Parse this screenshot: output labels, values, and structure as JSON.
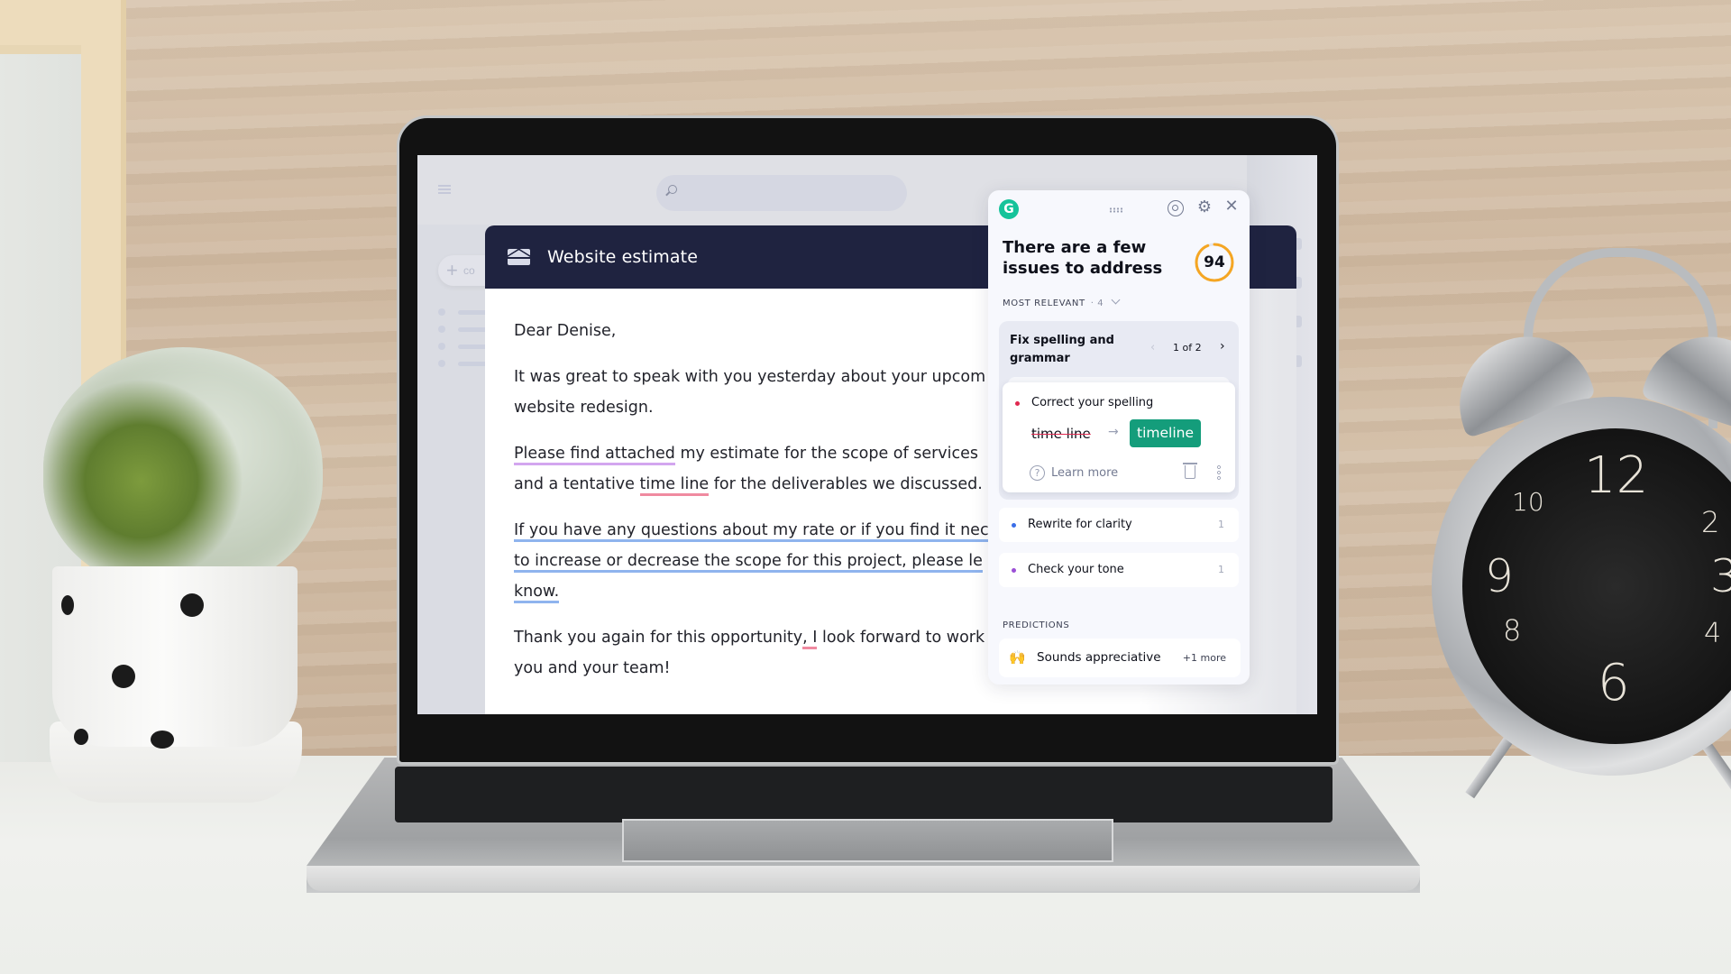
{
  "email_app": {
    "search": {
      "placeholder": ""
    },
    "compose_button_label": "co",
    "compose_window": {
      "title": "Website estimate",
      "body": {
        "greeting": "Dear Denise,",
        "paragraph1": {
          "line1": "It was great to speak with you yesterday about your upcom",
          "line2": "website redesign."
        },
        "paragraph2": {
          "flagged_tone": "Please find attached",
          "line1_rest": " my estimate for the scope of services",
          "line2_start": "and a tentative ",
          "flagged_spelling": "time line",
          "line2_rest": " for the deliverables we discussed."
        },
        "paragraph3": {
          "line1": "If you have any questions about my rate or if you find it nec",
          "line2": "to increase or decrease the scope for this project, please le",
          "line3": "know."
        },
        "paragraph4": {
          "line1_start": "Thank you again for this opportunity",
          "flagged_punctuation": ", I",
          "line1_rest": " look forward to work",
          "line2": "you and your team!"
        }
      }
    }
  },
  "grammarly_panel": {
    "logo_letter": "G",
    "heading": "There are a few issues to address",
    "score": 94,
    "score_fraction": 0.94,
    "filter": {
      "label": "MOST RELEVANT",
      "count": "· 4"
    },
    "group": {
      "title": "Fix spelling and grammar",
      "pager": "1 of 2",
      "card": {
        "label": "Correct your spelling",
        "original": "time line",
        "replacement": "timeline",
        "learn_more": "Learn more"
      }
    },
    "items": [
      {
        "label": "Rewrite for clarity",
        "count": "1",
        "color": "#3a6ee8"
      },
      {
        "label": "Check your tone",
        "count": "1",
        "color": "#9b4fd6"
      }
    ],
    "predictions": {
      "title": "PREDICTIONS",
      "label": "Sounds appreciative",
      "more": "+1 more",
      "emoji": "🙌"
    }
  },
  "colors": {
    "grammarly_green": "#15c39a",
    "replacement_green": "#149d7b",
    "compose_header": "#1f2340",
    "spelling_red": "#e0284f",
    "score_ring": "#f5a623"
  }
}
